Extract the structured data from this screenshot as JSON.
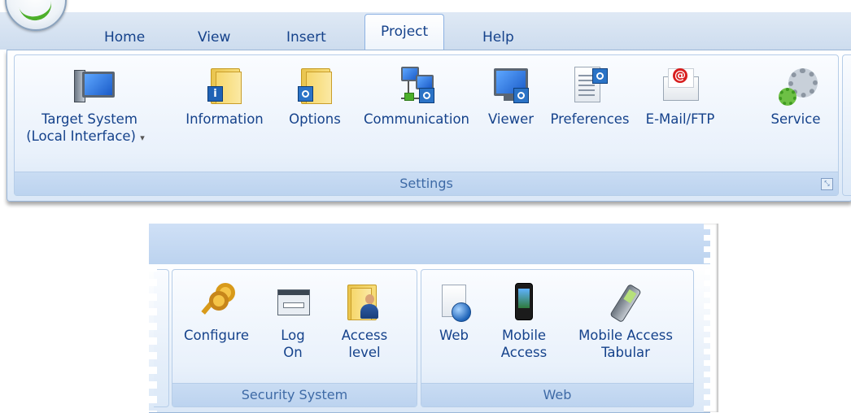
{
  "ribbon_top": {
    "tabs": [
      "Home",
      "View",
      "Insert",
      "Project",
      "Help"
    ],
    "active_tab": "Project",
    "settings_group": {
      "label": "Settings",
      "buttons": {
        "target_system": {
          "line1": "Target System",
          "line2": "(Local Interface)",
          "dropdown_glyph": "▾",
          "icon": "computer-icon"
        },
        "information": {
          "label": "Information",
          "icon": "folder-info-icon"
        },
        "options": {
          "label": "Options",
          "icon": "folder-settings-icon"
        },
        "communication": {
          "label": "Communication",
          "icon": "network-icon"
        },
        "viewer": {
          "label": "Viewer",
          "icon": "monitor-settings-icon"
        },
        "preferences": {
          "label": "Preferences",
          "icon": "document-settings-icon"
        },
        "email_ftp": {
          "label": "E-Mail/FTP",
          "icon": "envelope-icon"
        },
        "service": {
          "label": "Service",
          "icon": "gears-icon"
        }
      },
      "launcher_glyph": "⤡"
    }
  },
  "ribbon_bottom": {
    "security_group": {
      "label": "Security System",
      "buttons": {
        "configure": {
          "label": "Configure",
          "icon": "keys-icon"
        },
        "log_on": {
          "line1": "Log",
          "line2": "On",
          "icon": "login-dialog-icon"
        },
        "access_level": {
          "line1": "Access",
          "line2": "level",
          "icon": "folder-user-icon"
        }
      }
    },
    "web_group": {
      "label": "Web",
      "buttons": {
        "web": {
          "label": "Web",
          "icon": "web-page-icon"
        },
        "mobile_access": {
          "line1": "Mobile",
          "line2": "Access",
          "icon": "smartphone-icon"
        },
        "mobile_access_tabular": {
          "line1": "Mobile Access",
          "line2": "Tabular",
          "icon": "pda-icon"
        }
      }
    }
  },
  "colors": {
    "ribbon_text": "#15428b",
    "group_label_text": "#3e6aa6",
    "tab_bar": "#cddcee",
    "border": "#9ab6d8"
  }
}
